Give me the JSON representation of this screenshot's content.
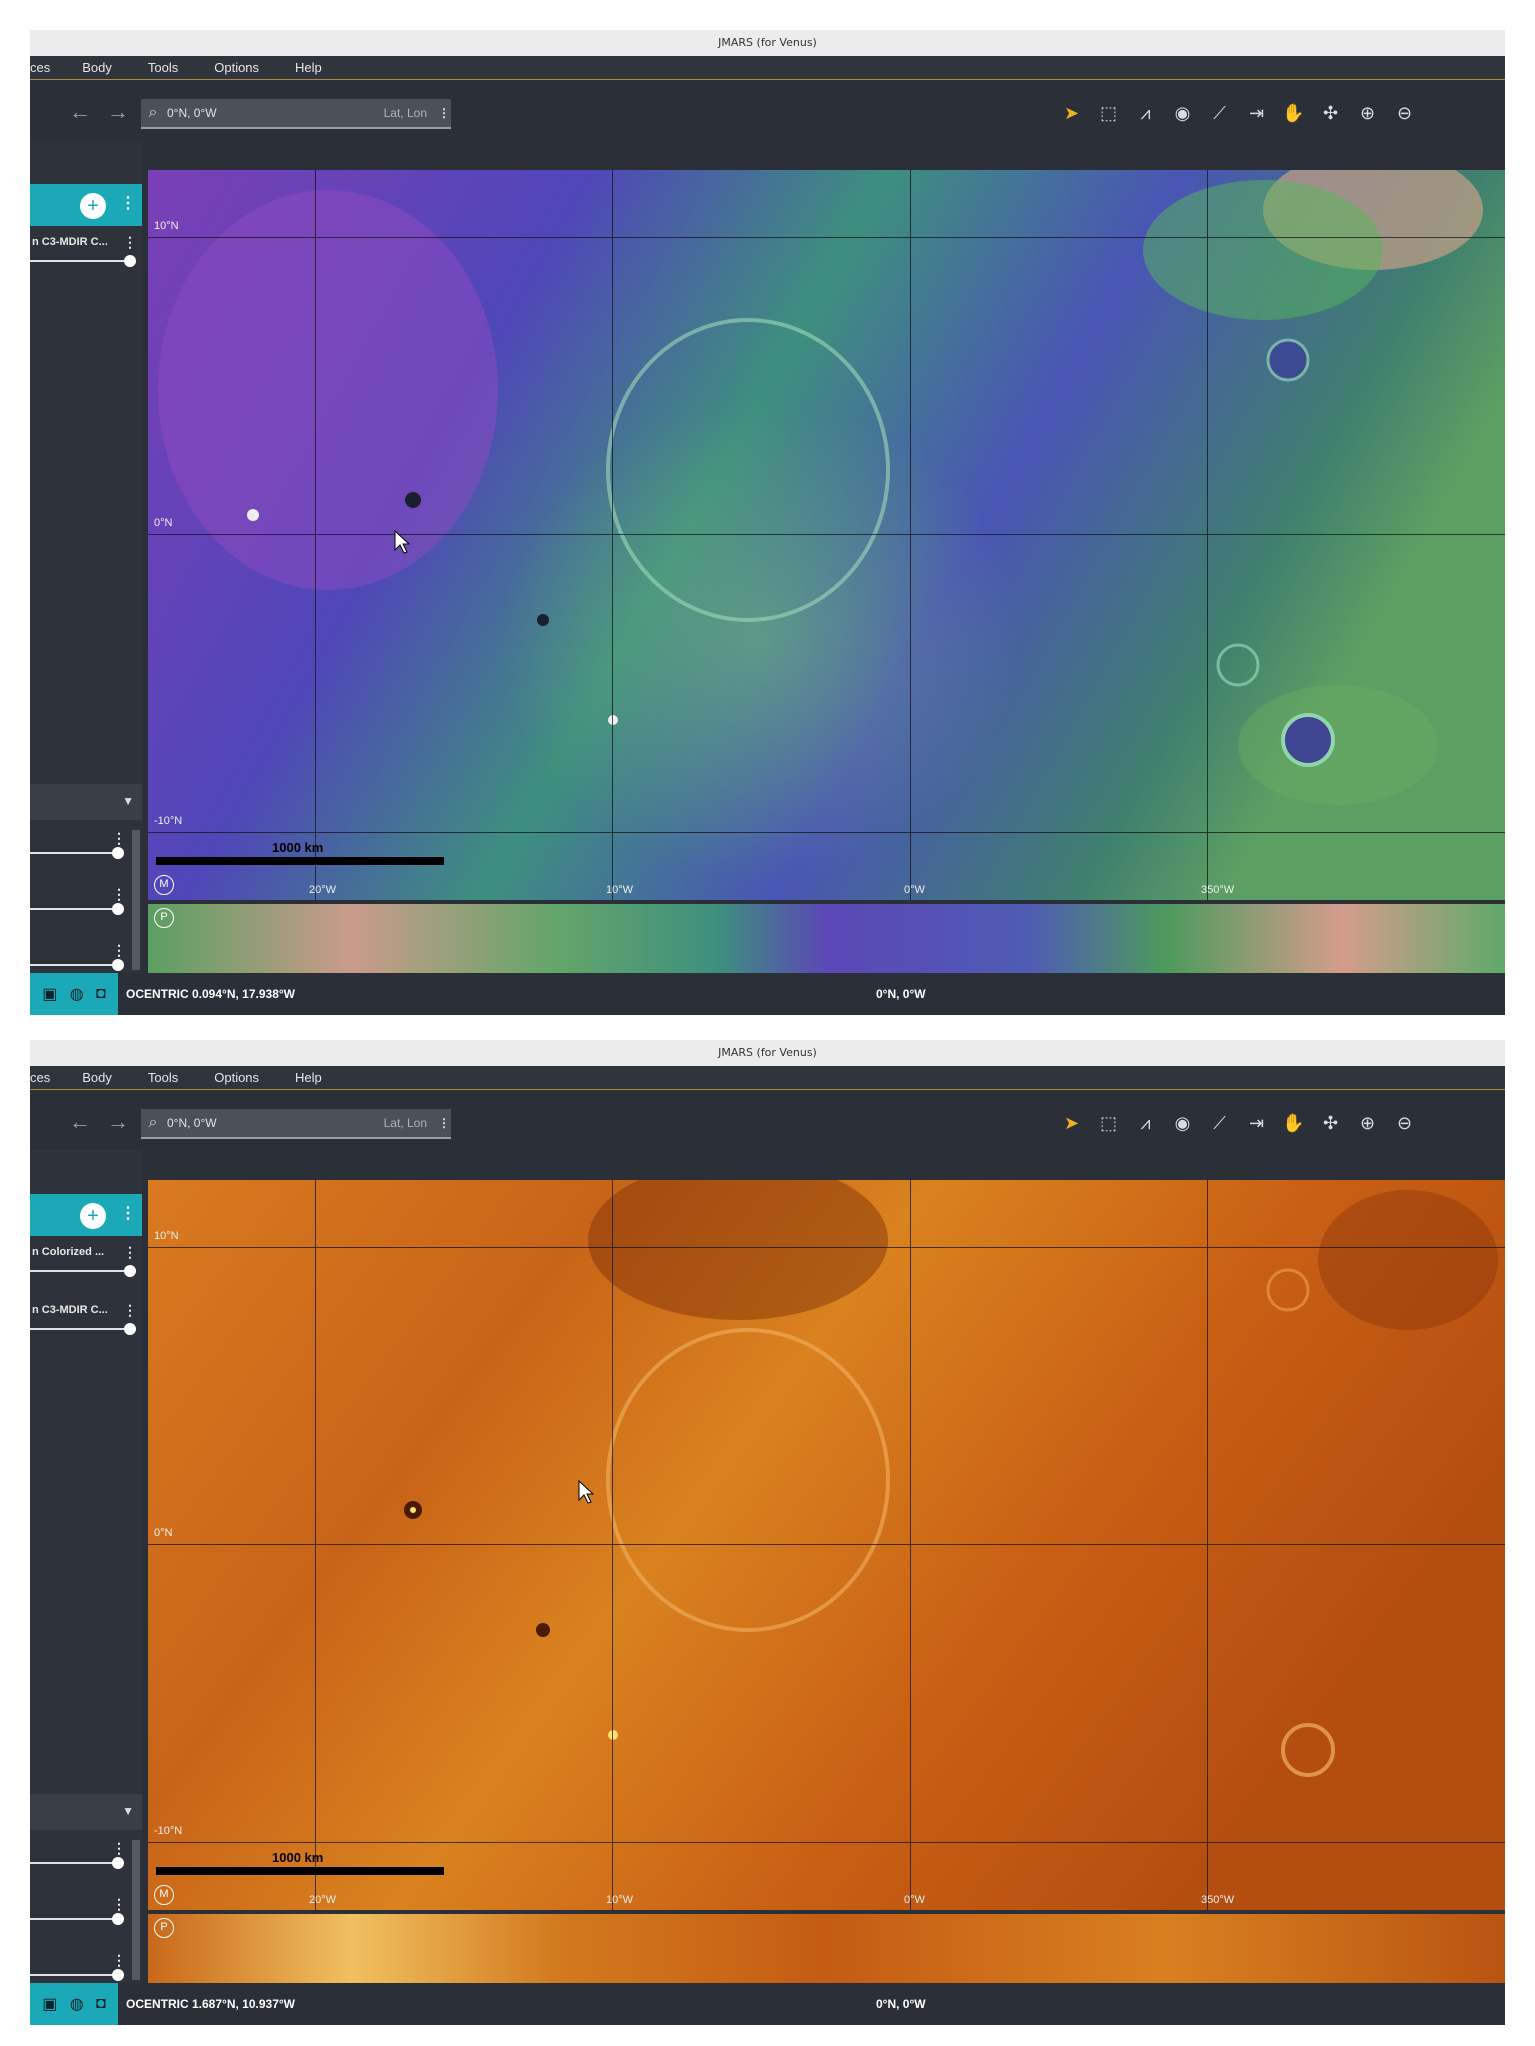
{
  "windows": [
    {
      "title": "JMARS (for Venus)",
      "menu": [
        "ces",
        "Body",
        "Tools",
        "Options",
        "Help"
      ],
      "search": {
        "value": "0°N, 0°W",
        "mode": "Lat, Lon"
      },
      "layers": [
        {
          "name": "n C3-MDIR C..."
        }
      ],
      "lat_labels": [
        "10°N",
        "0°N",
        "-10°N"
      ],
      "lon_labels": [
        "20°W",
        "10°W",
        "0°W",
        "350°W"
      ],
      "scale_label": "1000 km",
      "map_badge": "M",
      "panner_badge": "P",
      "status": {
        "coord": "OCENTRIC 0.094°N, 17.938°W",
        "center": "0°N, 0°W"
      },
      "theme": "colorized"
    },
    {
      "title": "JMARS (for Venus)",
      "menu": [
        "ces",
        "Body",
        "Tools",
        "Options",
        "Help"
      ],
      "search": {
        "value": "0°N, 0°W",
        "mode": "Lat, Lon"
      },
      "layers": [
        {
          "name": "n Colorized ..."
        },
        {
          "name": "n C3-MDIR C..."
        }
      ],
      "lat_labels": [
        "10°N",
        "0°N",
        "-10°N"
      ],
      "lon_labels": [
        "20°W",
        "10°W",
        "0°W",
        "350°W"
      ],
      "scale_label": "1000 km",
      "map_badge": "M",
      "panner_badge": "P",
      "status": {
        "coord": "OCENTRIC 1.687°N, 10.937°W",
        "center": "0°N, 0°W"
      },
      "theme": "orange"
    }
  ],
  "colors": {
    "accent": "#1ba9b7",
    "menu_underline": "#b08a3a",
    "active_tool": "#f0b020"
  },
  "icons": [
    "back-arrow-icon",
    "forward-arrow-icon",
    "search-icon",
    "pointer-icon",
    "select-icon",
    "chart-icon",
    "eye-icon",
    "ruler-icon",
    "export-icon",
    "hand-icon",
    "fit-icon",
    "zoom-in-icon",
    "zoom-out-icon"
  ]
}
